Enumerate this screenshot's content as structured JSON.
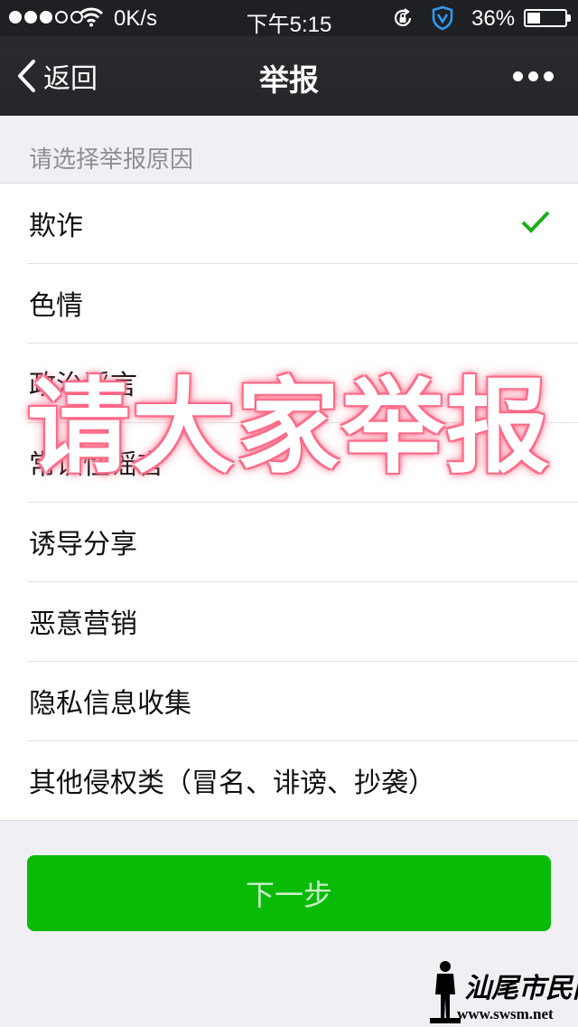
{
  "status_bar": {
    "speed": "0K/s",
    "time": "下午5:15",
    "battery_text": "36%",
    "battery_level": 0.36,
    "signal_filled": 3,
    "signal_total": 5
  },
  "nav": {
    "back_label": "返回",
    "title": "举报"
  },
  "section_header": "请选择举报原因",
  "reasons": [
    {
      "label": "欺诈",
      "selected": true
    },
    {
      "label": "色情",
      "selected": false
    },
    {
      "label": "政治谣言",
      "selected": false
    },
    {
      "label": "常识性谣言",
      "selected": false
    },
    {
      "label": "诱导分享",
      "selected": false
    },
    {
      "label": "恶意营销",
      "selected": false
    },
    {
      "label": "隐私信息收集",
      "selected": false
    },
    {
      "label": "其他侵权类（冒名、诽谤、抄袭）",
      "selected": false
    }
  ],
  "overlay_text": "请大家举报",
  "next_button": "下一步",
  "watermark": {
    "name": "汕尾市民网",
    "url": "www.swsm.net"
  },
  "colors": {
    "accent_green": "#09bb07",
    "check_green": "#1aad19",
    "overlay_glow": "#ff5f7f",
    "nav_bg": "#25262a",
    "page_bg": "#efeff4"
  },
  "icons": {
    "back": "chevron-left-icon",
    "more": "more-dots-icon",
    "selected": "check-icon",
    "wifi": "wifi-icon",
    "orientation_lock": "orientation-lock-icon",
    "security": "shield-icon",
    "battery": "battery-icon"
  }
}
